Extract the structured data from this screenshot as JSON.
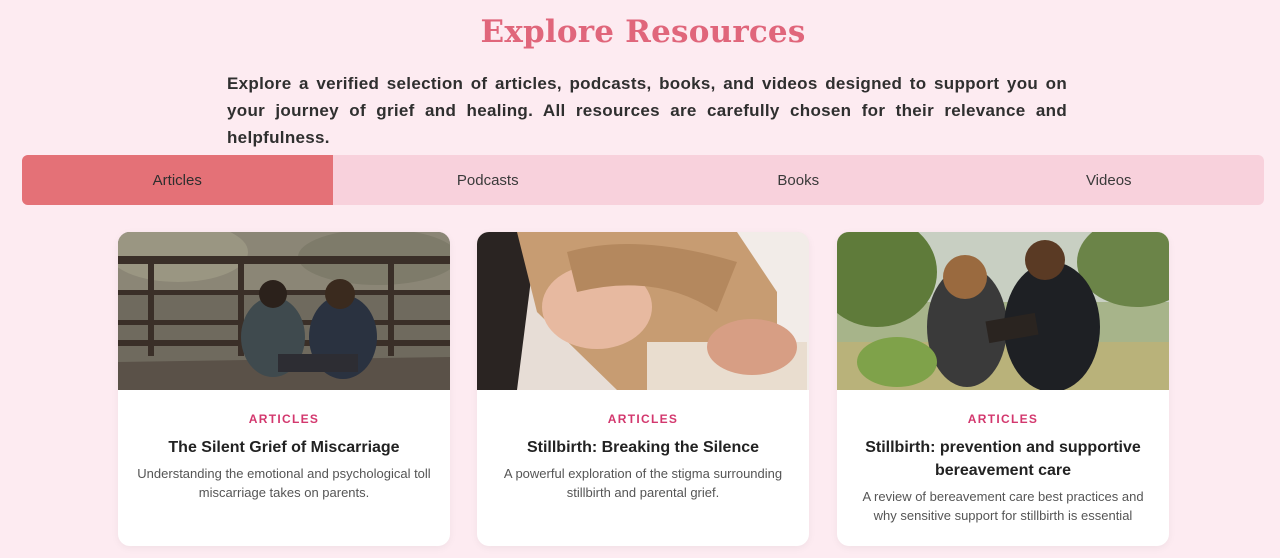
{
  "header": {
    "title": "Explore Resources",
    "intro": "Explore a verified selection of articles, podcasts, books, and videos designed to support you on your journey of grief and healing. All resources are carefully chosen for their relevance and helpfulness."
  },
  "tabs": [
    {
      "label": "Articles",
      "active": true
    },
    {
      "label": "Podcasts",
      "active": false
    },
    {
      "label": "Books",
      "active": false
    },
    {
      "label": "Videos",
      "active": false
    }
  ],
  "cards": [
    {
      "category": "ARTICLES",
      "title": "The Silent Grief of Miscarriage",
      "description": "Understanding the emotional and psychological toll miscarriage takes on parents.",
      "image": "two-women-sitting-on-porch-photo"
    },
    {
      "category": "ARTICLES",
      "title": "Stillbirth: Breaking the Silence",
      "description": "A powerful exploration of the stigma surrounding stillbirth and parental grief.",
      "image": "woman-comforted-hand-on-shoulder-photo"
    },
    {
      "category": "ARTICLES",
      "title": "Stillbirth: prevention and supportive bereavement care",
      "description": "A review of bereavement care best practices and why sensitive support for stillbirth is essential",
      "image": "couple-reading-book-outdoors-photo"
    }
  ],
  "colors": {
    "background": "#fdebf1",
    "accent": "#e0667b",
    "tab_active": "#e47177",
    "tab_bar": "#f8d1dc",
    "category": "#d3386e"
  }
}
